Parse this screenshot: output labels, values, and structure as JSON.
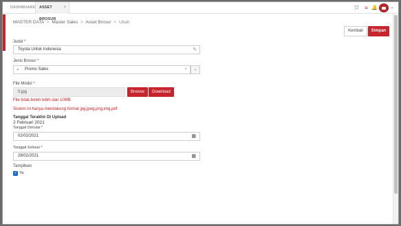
{
  "tabs": [
    {
      "label": "DASHBOARD"
    },
    {
      "label": "ASSET BROSUR",
      "close": "×"
    }
  ],
  "header_icons": {
    "expand": "⤧",
    "menu": "≡",
    "bell": "🔔",
    "caret": "⌄"
  },
  "breadcrumb": {
    "items": [
      "MASTER DATA",
      "Master Sales",
      "Asset Brosur",
      "Ubah"
    ],
    "separator": ">"
  },
  "actions": {
    "back_label": "Kembali",
    "save_label": "Simpan"
  },
  "form": {
    "judul": {
      "label": "Judul",
      "required": "*",
      "value": "Toyota Untuk Indonesia"
    },
    "jenis_brosur": {
      "label": "Jenis Brosur",
      "required": "*",
      "value": "Promo Sales",
      "clear": "×",
      "dropdown": "⌄"
    },
    "file_modul": {
      "label": "File Modul",
      "required": "*",
      "value": "0.jpg",
      "browse_label": "Browse",
      "download_label": "Download",
      "error_size": "File tidak boleh lebih dari 10MB",
      "error_format": "Sistem ini hanya mendukung format jpg,jpeg,png,img,pdf"
    },
    "tanggal_upload": {
      "title": "Tanggal Terakhir Di Upload",
      "value": "2 Februari 2021"
    },
    "tanggal_dimulai": {
      "label": "Tanggal Dimulai",
      "required": "*",
      "value": "02/02/2021"
    },
    "tanggal_selesai": {
      "label": "Tanggal Selesai",
      "required": "*",
      "value": "28/02/2021"
    },
    "tampilkan": {
      "label": "Tampilkan",
      "option_label": "Ya",
      "checked": true
    }
  },
  "colors": {
    "primary": "#c7242c",
    "checkbox": "#1f6fd1",
    "error": "#d0191f"
  }
}
